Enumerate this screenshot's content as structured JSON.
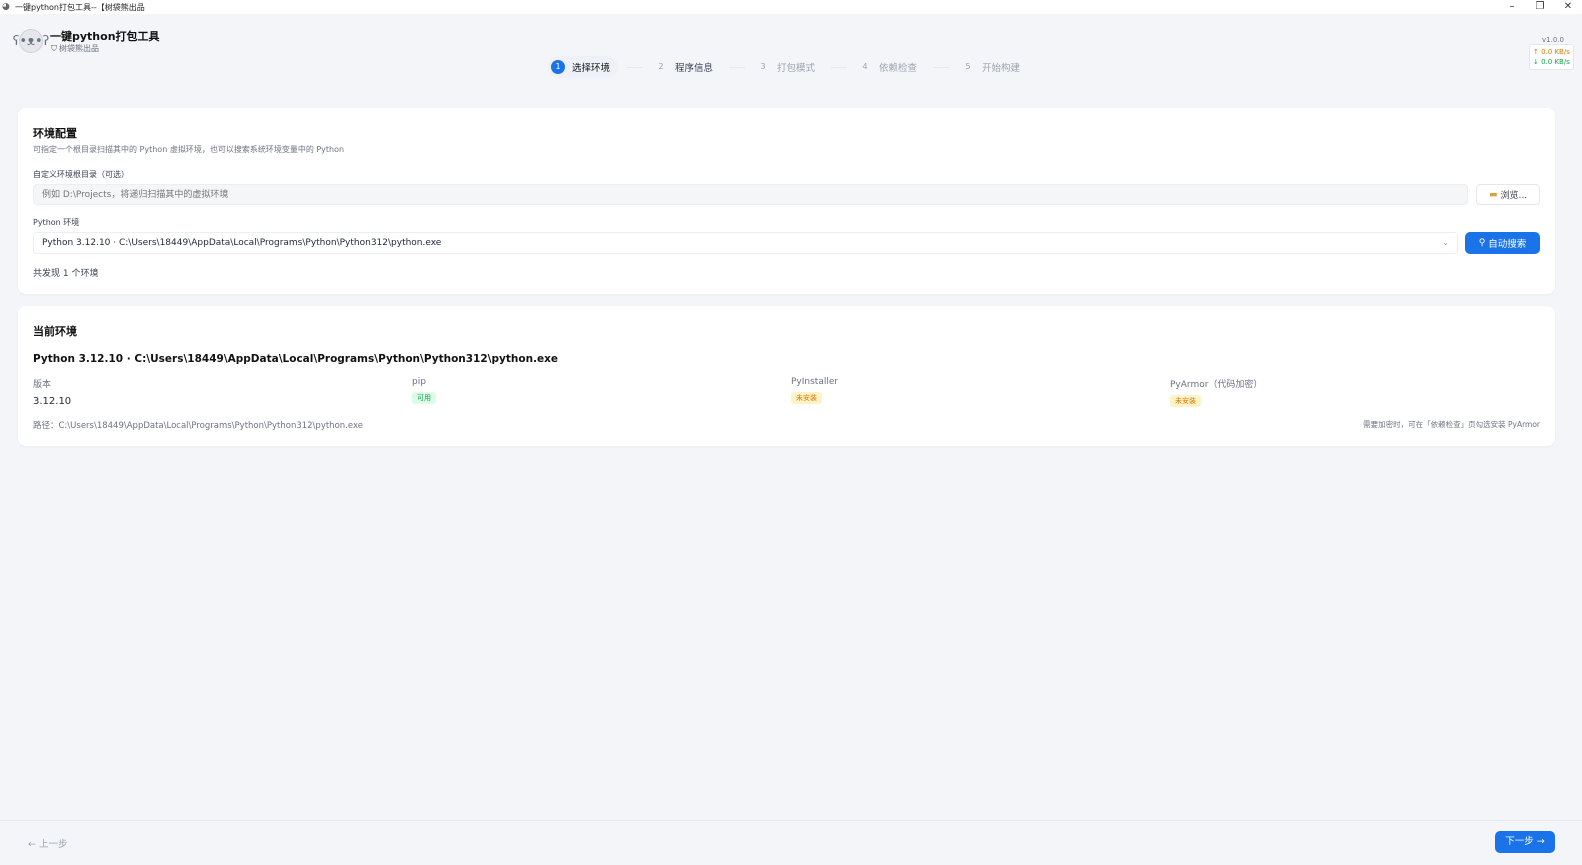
{
  "window": {
    "title": "一键python打包工具--【树袋熊出品",
    "minimize": "–",
    "restore": "❐",
    "close": "✕"
  },
  "header": {
    "brand_title": "一键python打包工具",
    "brand_sub": "树袋熊出品",
    "version": "v1.0.0",
    "net_up": "↑ 0.0 KB/s",
    "net_down": "↓ 0.0 KB/s"
  },
  "steps": [
    {
      "num": "1",
      "label": "选择环境",
      "state": "active"
    },
    {
      "num": "2",
      "label": "程序信息",
      "state": "done"
    },
    {
      "num": "3",
      "label": "打包模式",
      "state": "todo"
    },
    {
      "num": "4",
      "label": "依赖检查",
      "state": "todo"
    },
    {
      "num": "5",
      "label": "开始构建",
      "state": "todo"
    }
  ],
  "env_config": {
    "title": "环境配置",
    "desc": "可指定一个根目录扫描其中的 Python 虚拟环境，也可以搜索系统环境变量中的 Python",
    "custom_dir_label": "自定义环境根目录（可选）",
    "custom_dir_placeholder": "例如 D:\\Projects，将递归扫描其中的虚拟环境",
    "browse_label": "浏览...",
    "python_env_label": "Python 环境",
    "python_env_selected": "Python 3.12.10 · C:\\Users\\18449\\AppData\\Local\\Programs\\Python\\Python312\\python.exe",
    "auto_search_label": "自动搜索",
    "found_text": "共发现 1 个环境"
  },
  "current_env": {
    "title": "当前环境",
    "name": "Python 3.12.10 · C:\\Users\\18449\\AppData\\Local\\Programs\\Python\\Python312\\python.exe",
    "version_head": "版本",
    "version_val": "3.12.10",
    "pip_head": "pip",
    "pip_status": "可用",
    "pyinstaller_head": "PyInstaller",
    "pyinstaller_status": "未安装",
    "pyarmor_head": "PyArmor（代码加密）",
    "pyarmor_status": "未安装",
    "path_line": "路径：C:\\Users\\18449\\AppData\\Local\\Programs\\Python\\Python312\\python.exe",
    "hint": "需要加密时，可在「依赖检查」页勾选安装 PyArmor"
  },
  "footer": {
    "prev_label": "← 上一步",
    "next_label": "下一步 →"
  },
  "colors": {
    "accent": "#1a73e8",
    "ok": "#16a34a",
    "warn": "#d97706"
  }
}
